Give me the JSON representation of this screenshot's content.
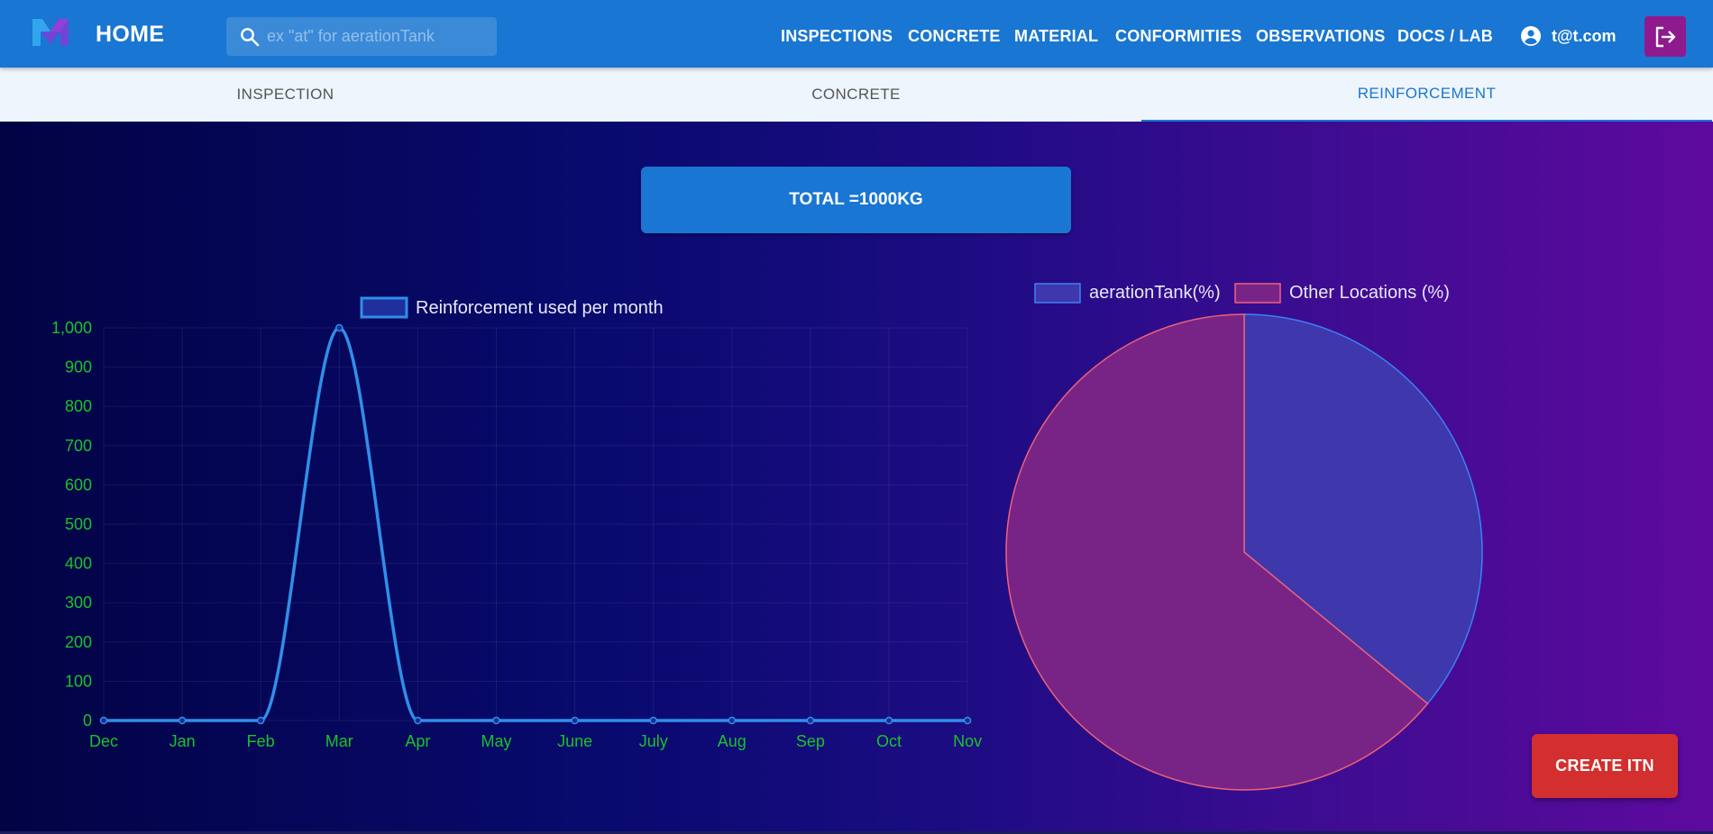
{
  "app": {
    "home_label": "HOME",
    "search_placeholder": "ex \"at\" for aerationTank",
    "nav": [
      "INSPECTIONS",
      "CONCRETE",
      "MATERIAL",
      "CONFORMITIES",
      "OBSERVATIONS",
      "DOCS / LAB"
    ],
    "user_email": "t@t.com",
    "brand_color": "#1976d2",
    "logout_color": "#8e1a8e",
    "icons": [
      "logo-icon",
      "search-icon",
      "account-circle-icon",
      "logout-icon"
    ]
  },
  "tabs": {
    "items": [
      "INSPECTION",
      "CONCRETE",
      "REINFORCEMENT"
    ],
    "active": "REINFORCEMENT"
  },
  "summary": {
    "total_label": "TOTAL =",
    "total_value": "1000",
    "total_unit": "KG"
  },
  "actions": {
    "create_label": "CREATE ITN",
    "create_color": "#d32f2f"
  },
  "chart_data": [
    {
      "type": "line",
      "categories": [
        "Dec",
        "Jan",
        "Feb",
        "Mar",
        "Apr",
        "May",
        "June",
        "July",
        "Aug",
        "Sep",
        "Oct",
        "Nov"
      ],
      "series": [
        {
          "name": "Reinforcement used per month",
          "values": [
            0,
            0,
            0,
            1000,
            0,
            0,
            0,
            0,
            0,
            0,
            0,
            0
          ],
          "color": "#2f8fe8"
        }
      ],
      "ylim": [
        0,
        1000
      ],
      "yticks": [
        "0",
        "100",
        "200",
        "300",
        "400",
        "500",
        "600",
        "700",
        "800",
        "900",
        "1,000"
      ],
      "tick_color": "#19c32a",
      "grid": true,
      "legend": "top-center",
      "smooth": true
    },
    {
      "type": "pie",
      "labels": [
        "aerationTank(%)",
        "Other Locations (%)"
      ],
      "values": [
        36,
        64
      ],
      "fill_colors": [
        "#3f37ac",
        "#782486"
      ],
      "border_colors": [
        "#3b82f6",
        "#f0607a"
      ],
      "legend": "top-center"
    }
  ]
}
